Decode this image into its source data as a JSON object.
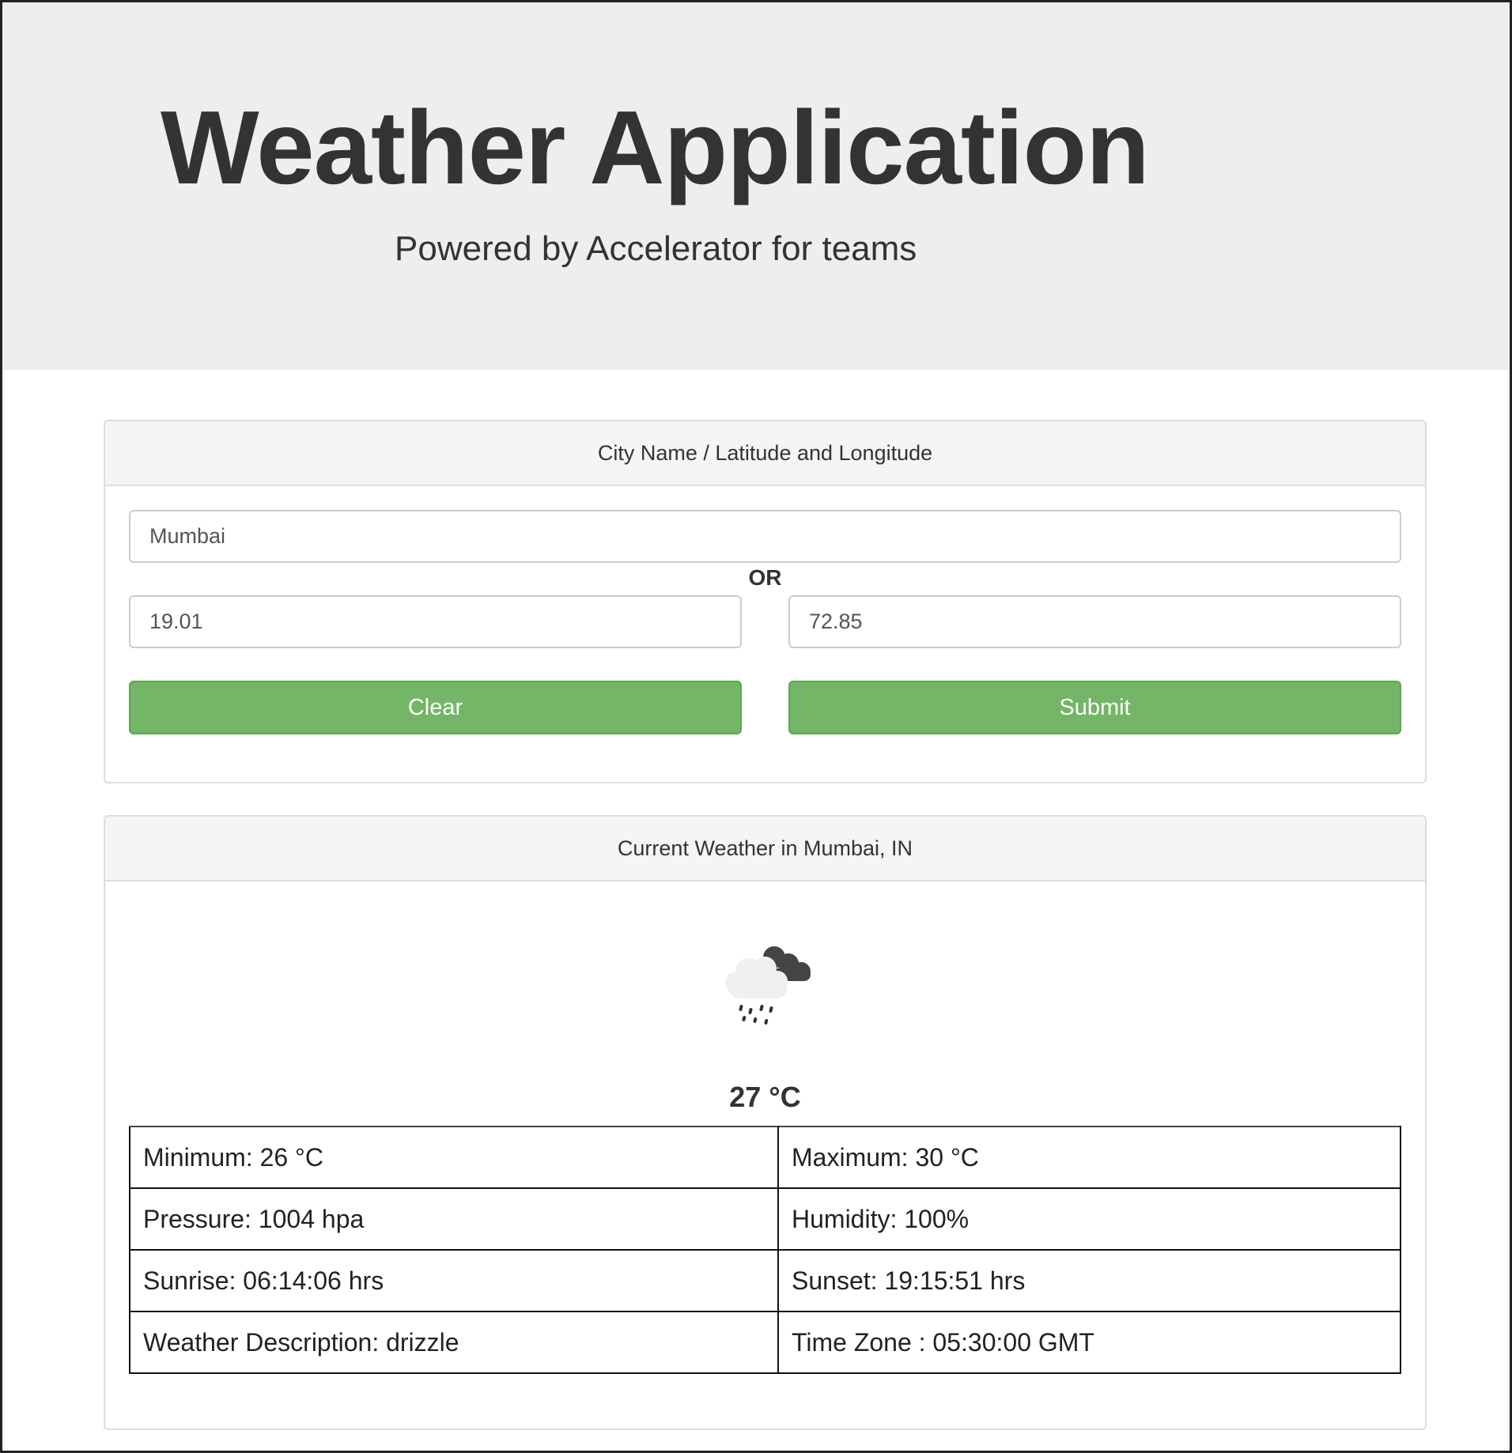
{
  "header": {
    "title": "Weather Application",
    "subtitle": "Powered by Accelerator for teams"
  },
  "form": {
    "heading": "City Name / Latitude and Longitude",
    "city_value": "Mumbai",
    "or_label": "OR",
    "latitude_value": "19.01",
    "longitude_value": "72.85",
    "clear_label": "Clear",
    "submit_label": "Submit"
  },
  "result": {
    "heading": "Current Weather in Mumbai, IN",
    "icon": "drizzle-cloud-icon",
    "temperature": "27 °C",
    "rows": [
      [
        "Minimum: 26 °C",
        "Maximum: 30 °C"
      ],
      [
        "Pressure: 1004 hpa",
        "Humidity: 100%"
      ],
      [
        "Sunrise: 06:14:06 hrs",
        "Sunset: 19:15:51 hrs"
      ],
      [
        "Weather Description: drizzle",
        "Time Zone : 05:30:00 GMT"
      ]
    ]
  },
  "colors": {
    "button_green": "#73b667",
    "jumbotron_gray": "#eeeeee",
    "panel_heading_gray": "#f5f5f5"
  }
}
